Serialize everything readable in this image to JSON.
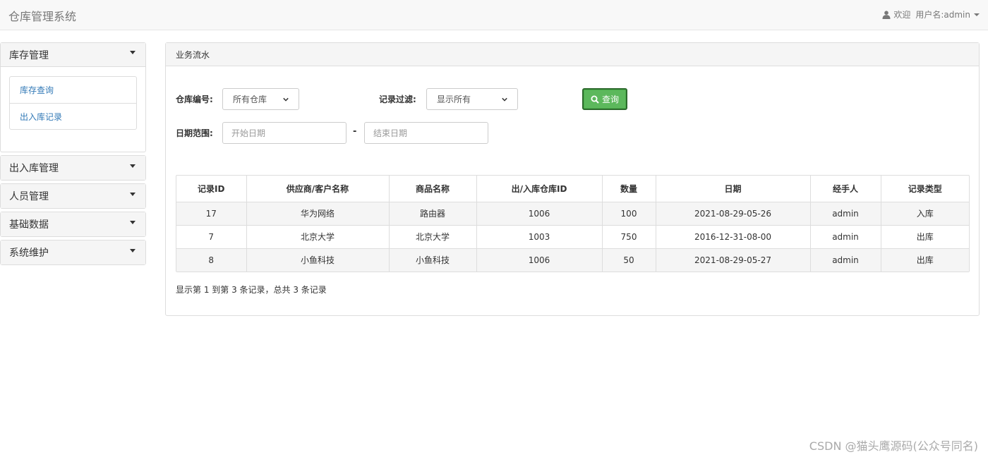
{
  "app": {
    "title": "仓库管理系统"
  },
  "user": {
    "greeting": "欢迎",
    "username_label": "用户名:admin"
  },
  "sidebar": {
    "groups": [
      {
        "label": "库存管理",
        "expanded": true,
        "items": [
          "库存查询",
          "出入库记录"
        ]
      },
      {
        "label": "出入库管理"
      },
      {
        "label": "人员管理"
      },
      {
        "label": "基础数据"
      },
      {
        "label": "系统维护"
      }
    ]
  },
  "main": {
    "panel_title": "业务流水",
    "filters": {
      "warehouse_label": "仓库编号:",
      "warehouse_selected": "所有仓库",
      "record_filter_label": "记录过滤:",
      "record_filter_selected": "显示所有",
      "query_button": "查询",
      "date_range_label": "日期范围:",
      "start_date_placeholder": "开始日期",
      "end_date_placeholder": "结束日期",
      "separator": "-"
    },
    "table": {
      "columns": [
        "记录ID",
        "供应商/客户名称",
        "商品名称",
        "出/入库仓库ID",
        "数量",
        "日期",
        "经手人",
        "记录类型"
      ],
      "rows": [
        [
          "17",
          "华为网络",
          "路由器",
          "1006",
          "100",
          "2021-08-29-05-26",
          "admin",
          "入库"
        ],
        [
          "7",
          "北京大学",
          "北京大学",
          "1003",
          "750",
          "2016-12-31-08-00",
          "admin",
          "出库"
        ],
        [
          "8",
          "小鱼科技",
          "小鱼科技",
          "1006",
          "50",
          "2021-08-29-05-27",
          "admin",
          "出库"
        ]
      ]
    },
    "pagination_text": "显示第 1 到第 3 条记录，总共 3 条记录"
  },
  "watermark": "CSDN @猫头鹰源码(公众号同名)",
  "colors": {
    "primary_link": "#337ab7",
    "success_button": "#5cb85c",
    "panel_heading": "#f5f5f5"
  },
  "icons": {
    "user": "user-icon",
    "search": "search-icon",
    "caret": "caret-down-icon"
  }
}
